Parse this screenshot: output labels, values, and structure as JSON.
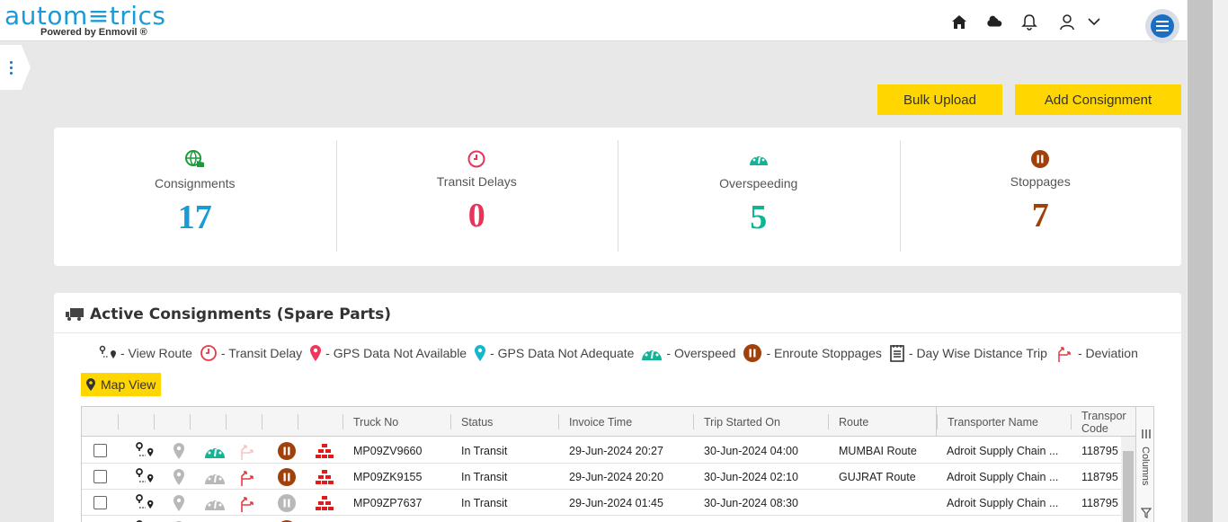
{
  "header": {
    "logo_text": "autom≡trics",
    "logo_sub": "Powered by Enmovil ®",
    "icons": [
      "home-icon",
      "weather-icon",
      "bell-icon",
      "user-icon",
      "chevron-down-icon",
      "menu-icon"
    ]
  },
  "actions": {
    "bulk_upload": "Bulk Upload",
    "add_consignment": "Add Consignment"
  },
  "stats": [
    {
      "label": "Consignments",
      "value": "17",
      "color": "#1a9bd7",
      "icon": "globe-hand-icon"
    },
    {
      "label": "Transit Delays",
      "value": "0",
      "color": "#e9335a",
      "icon": "clock-icon"
    },
    {
      "label": "Overspeeding",
      "value": "5",
      "color": "#13b396",
      "icon": "speedometer-icon"
    },
    {
      "label": "Stoppages",
      "value": "7",
      "color": "#a0410c",
      "icon": "pause-icon"
    }
  ],
  "panel": {
    "title": "Active Consignments (Spare Parts)",
    "map_view": "Map View",
    "columns_label": "Columns"
  },
  "legend": [
    {
      "label": "- View Route",
      "icon": "route-icon"
    },
    {
      "label": "- Transit Delay",
      "icon": "clock-icon"
    },
    {
      "label": "- GPS Data Not Available",
      "icon": "pin-red-icon"
    },
    {
      "label": "- GPS Data Not Adequate",
      "icon": "pin-teal-icon"
    },
    {
      "label": "- Overspeed",
      "icon": "speedometer-icon"
    },
    {
      "label": "- Enroute Stoppages",
      "icon": "pause-icon"
    },
    {
      "label": "- Day Wise Distance Trip",
      "icon": "notepad-icon"
    },
    {
      "label": "- Deviation",
      "icon": "deviation-icon"
    }
  ],
  "columns": [
    "Truck No",
    "Status",
    "Invoice Time",
    "Trip Started On",
    "Route",
    "Transporter Name",
    "Transporter Code"
  ],
  "rows": [
    {
      "truck": "MP09ZV9660",
      "status": "In Transit",
      "invoice": "29-Jun-2024 20:27",
      "trip": "30-Jun-2024 04:00",
      "route": "MUMBAI Route",
      "transporter": "Adroit Supply Chain ...",
      "code": "118795",
      "overspeed": true,
      "deviation": false,
      "stoppage": true
    },
    {
      "truck": "MP09ZK9155",
      "status": "In Transit",
      "invoice": "29-Jun-2024 20:20",
      "trip": "30-Jun-2024 02:10",
      "route": "GUJRAT Route",
      "transporter": "Adroit Supply Chain ...",
      "code": "118795",
      "overspeed": false,
      "deviation": true,
      "stoppage": true
    },
    {
      "truck": "MP09ZP7637",
      "status": "In Transit",
      "invoice": "29-Jun-2024 01:45",
      "trip": "30-Jun-2024 08:30",
      "route": "",
      "transporter": "Adroit Supply Chain ...",
      "code": "118795",
      "overspeed": false,
      "deviation": true,
      "stoppage": false
    }
  ]
}
